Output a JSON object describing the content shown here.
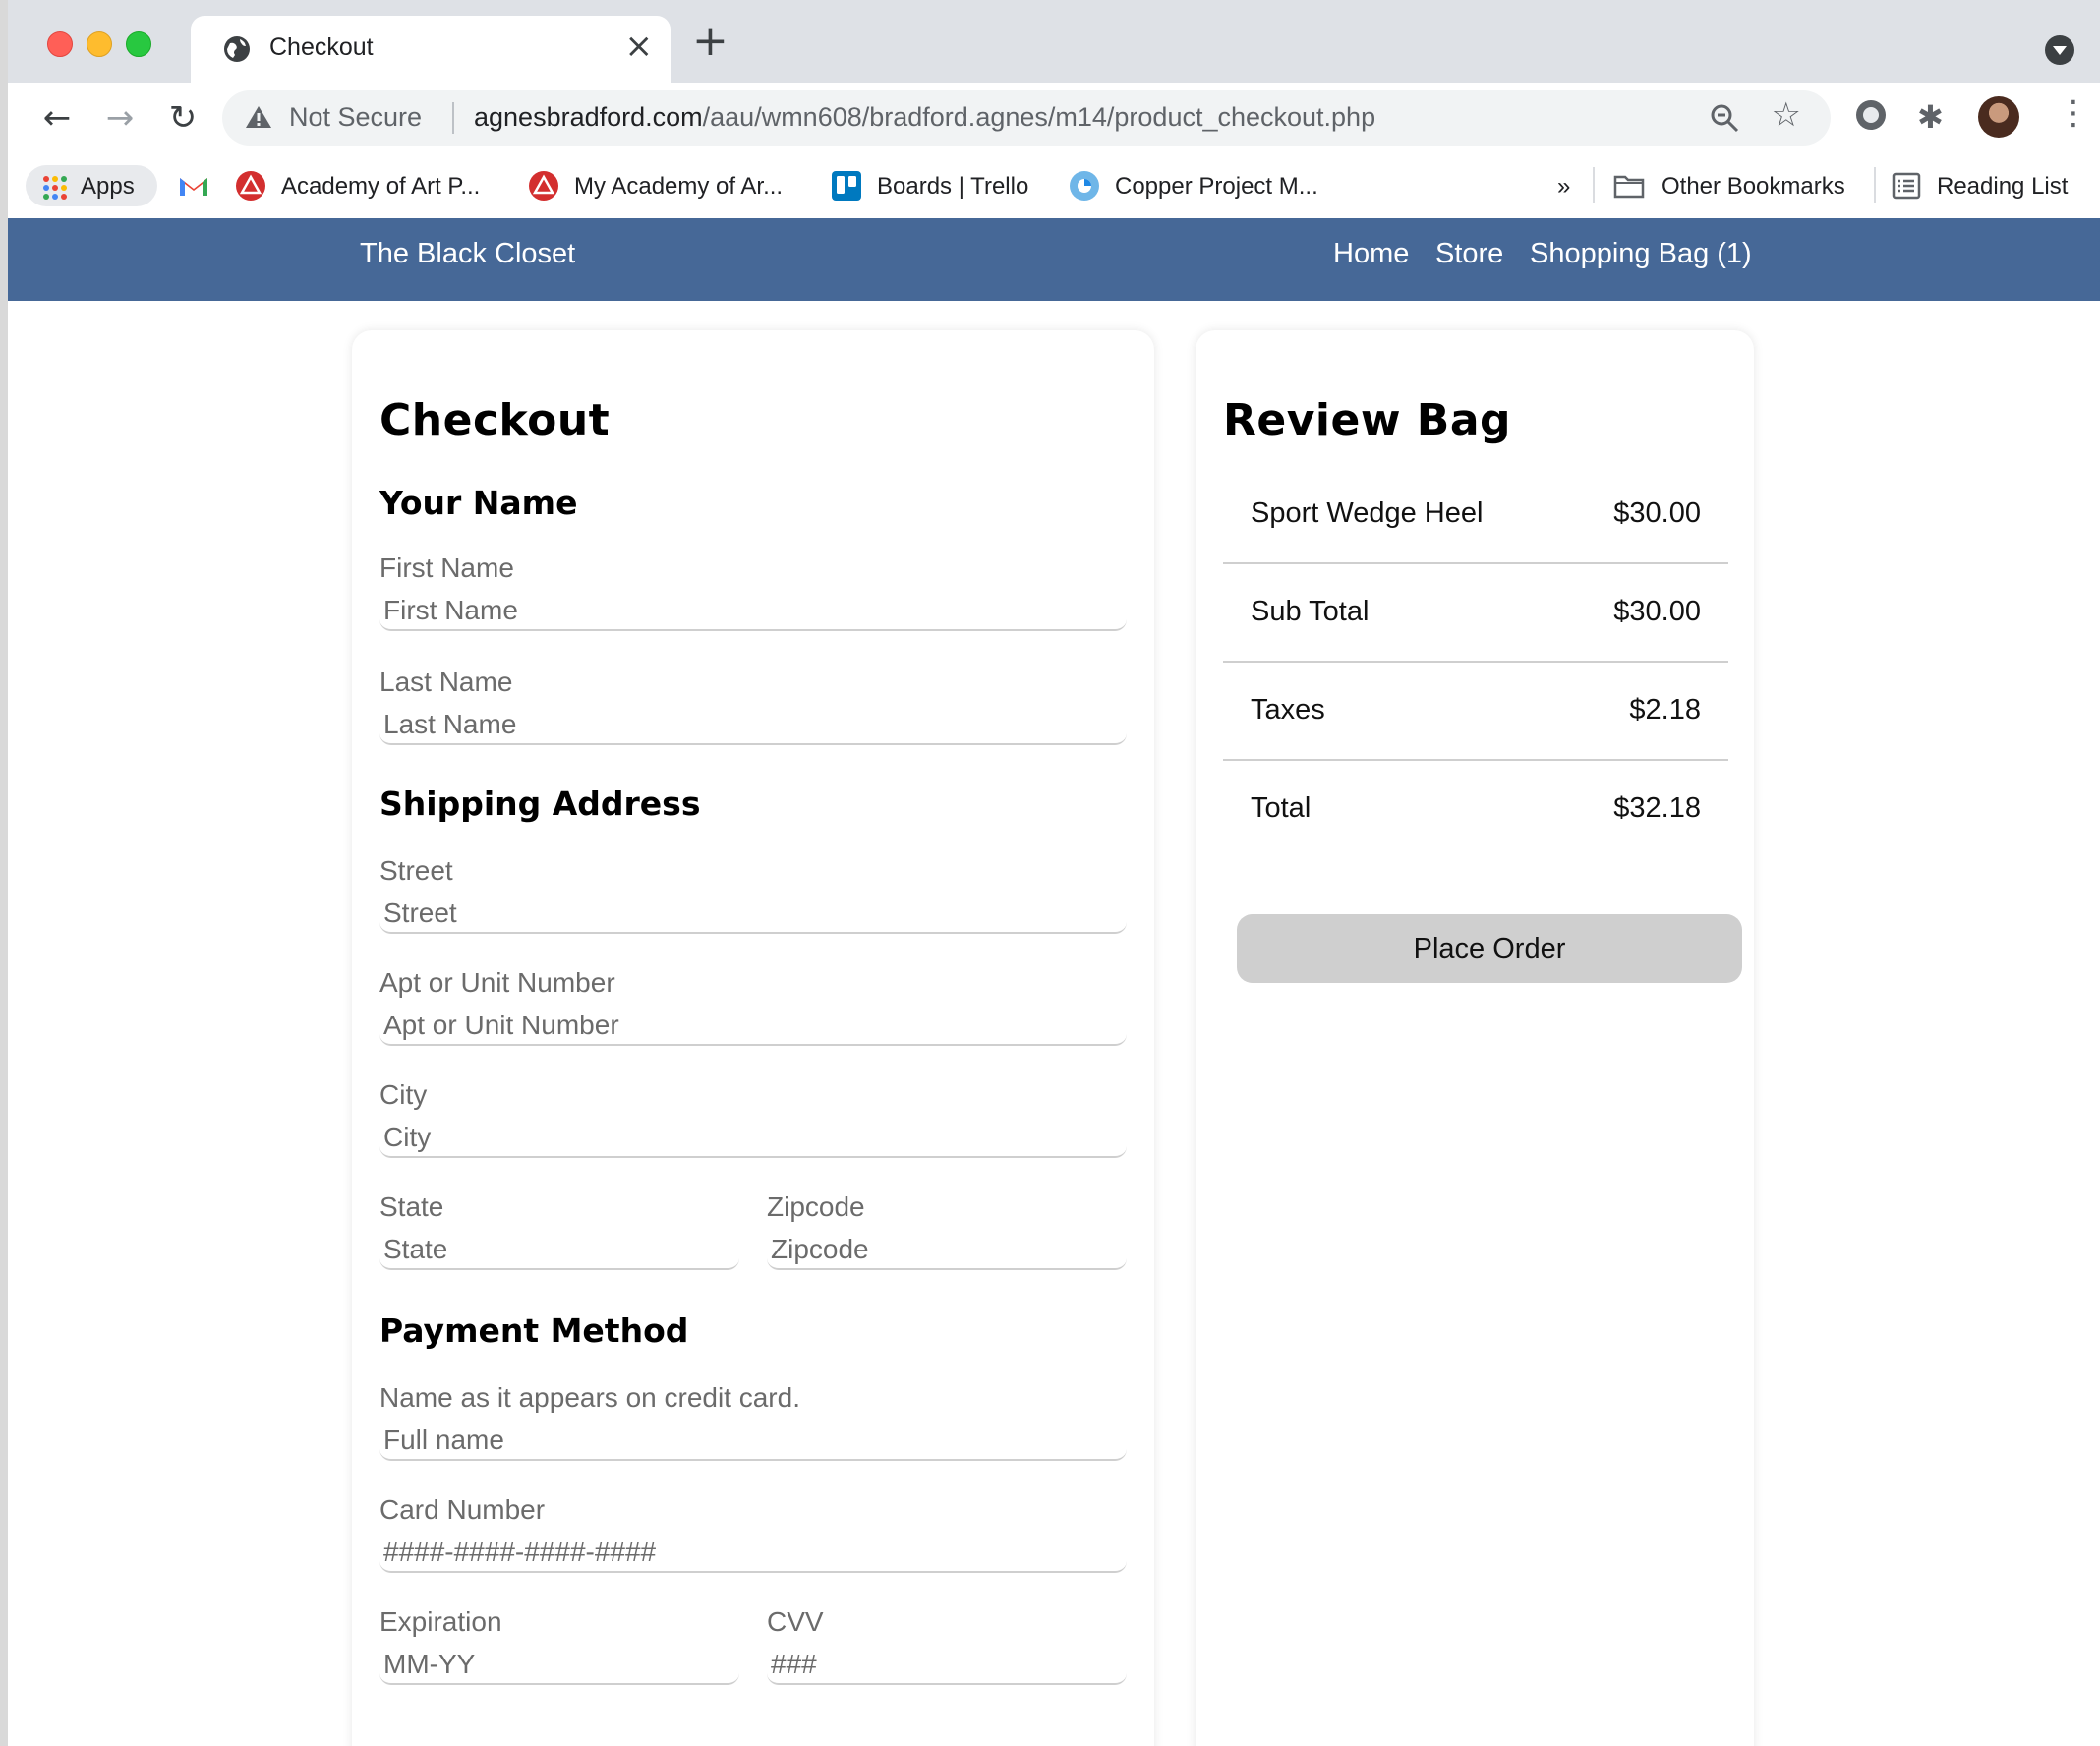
{
  "browser": {
    "tab_title": "Checkout",
    "security_label": "Not Secure",
    "url_host": "agnesbradford.com",
    "url_path": "/aau/wmn608/bradford.agnes/m14/product_checkout.php",
    "bookmarks": [
      {
        "label": "Apps",
        "icon": "apps-grid-icon"
      },
      {
        "label": "",
        "icon": "gmail-icon"
      },
      {
        "label": "Academy of Art P...",
        "icon": "academy-icon"
      },
      {
        "label": "My Academy of Ar...",
        "icon": "academy-icon"
      },
      {
        "label": "Boards | Trello",
        "icon": "trello-icon"
      },
      {
        "label": "Copper Project M...",
        "icon": "copper-icon"
      }
    ],
    "overflow_label": "»",
    "other_bookmarks": "Other Bookmarks",
    "reading_list": "Reading List"
  },
  "site": {
    "brand": "The Black Closet",
    "nav": [
      "Home",
      "Store",
      "Shopping Bag (1)"
    ],
    "accent_color": "#466897"
  },
  "checkout": {
    "title": "Checkout",
    "name_section": "Your Name",
    "first_name": {
      "label": "First Name",
      "placeholder": "First Name"
    },
    "last_name": {
      "label": "Last Name",
      "placeholder": "Last Name"
    },
    "shipping_section": "Shipping Address",
    "street": {
      "label": "Street",
      "placeholder": "Street"
    },
    "apt": {
      "label": "Apt or Unit Number",
      "placeholder": "Apt or Unit Number"
    },
    "city": {
      "label": "City",
      "placeholder": "City"
    },
    "state": {
      "label": "State",
      "placeholder": "State"
    },
    "zip": {
      "label": "Zipcode",
      "placeholder": "Zipcode"
    },
    "payment_section": "Payment Method",
    "card_name": {
      "label": "Name as it appears on credit card.",
      "placeholder": "Full name"
    },
    "card_number": {
      "label": "Card Number",
      "placeholder": "####-####-####-####"
    },
    "expiration": {
      "label": "Expiration",
      "placeholder": "MM-YY"
    },
    "cvv": {
      "label": "CVV",
      "placeholder": "###"
    }
  },
  "review": {
    "title": "Review Bag",
    "item": {
      "name": "Sport Wedge Heel",
      "price": "$30.00"
    },
    "subtotal": {
      "label": "Sub Total",
      "value": "$30.00"
    },
    "taxes": {
      "label": "Taxes",
      "value": "$2.18"
    },
    "total": {
      "label": "Total",
      "value": "$32.18"
    },
    "place_order": "Place Order"
  }
}
